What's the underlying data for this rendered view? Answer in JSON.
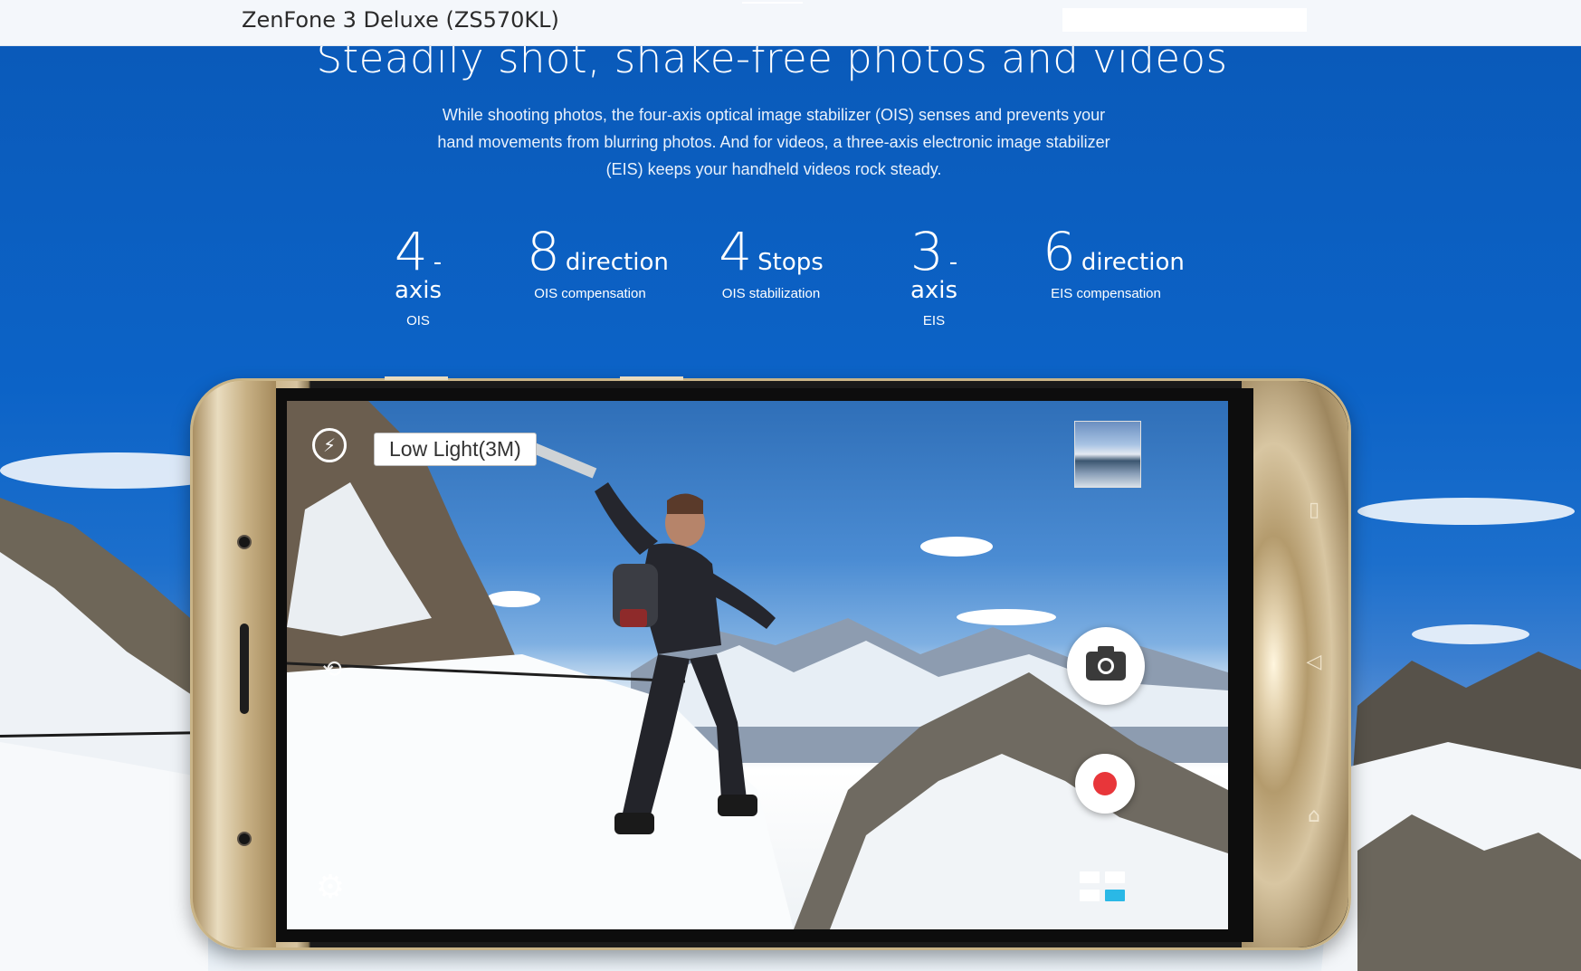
{
  "header": {
    "product_title": "ZenFone 3 Deluxe (ZS570KL)"
  },
  "hero": {
    "headline": "Steadily shot, shake-free photos and videos",
    "description": "While shooting photos, the four-axis optical image stabilizer (OIS) senses and prevents your hand movements from blurring photos. And for videos, a three-axis electronic image stabilizer (EIS) keeps your handheld videos rock steady.",
    "stats": [
      {
        "number": "4",
        "unit": "- axis",
        "caption": "OIS"
      },
      {
        "number": "8",
        "unit": "direction",
        "caption": "OIS compensation"
      },
      {
        "number": "4",
        "unit": "Stops",
        "caption": "OIS stabilization"
      },
      {
        "number": "3",
        "unit": "- axis",
        "caption": "EIS"
      },
      {
        "number": "6",
        "unit": "direction",
        "caption": "EIS compensation"
      }
    ]
  },
  "camera_ui": {
    "mode_label": "Low Light(3M)",
    "icons": {
      "flash": "flash-auto-icon",
      "switch_camera": "switch-camera-icon",
      "settings": "gear-icon",
      "shutter": "camera-icon",
      "record": "record-icon",
      "modes": "modes-grid-icon",
      "gallery": "gallery-thumbnail"
    },
    "colors": {
      "record": "#e8363a",
      "modes_accent": "#2ab8e6"
    }
  },
  "phone_buttons": {
    "recent": "recent-apps-icon",
    "back": "back-icon",
    "home": "home-icon"
  },
  "theme": {
    "accent": "#0b5dbf"
  }
}
